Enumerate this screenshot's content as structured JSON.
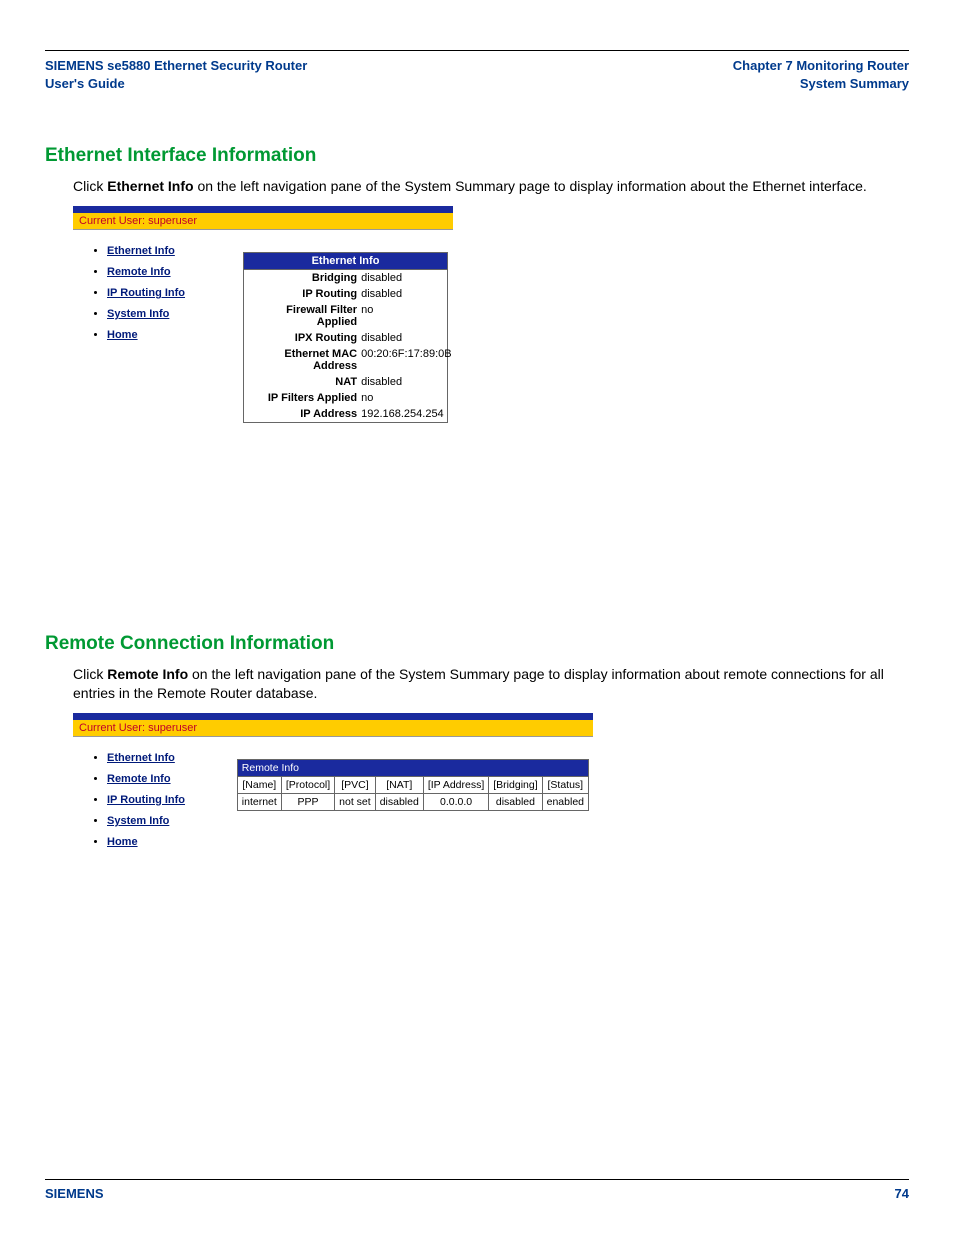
{
  "header": {
    "left_line1": "SIEMENS se5880 Ethernet Security Router",
    "left_line2": "User's Guide",
    "right_line1": "Chapter 7  Monitoring Router",
    "right_line2": "System Summary"
  },
  "section1": {
    "heading": "Ethernet Interface Information",
    "para_pre": "Click ",
    "para_bold": "Ethernet Info",
    "para_post": " on the left navigation pane of the System Summary page to display information about the Ethernet interface."
  },
  "app": {
    "current_user_label": "Current User: superuser",
    "nav": [
      "Ethernet Info",
      "Remote Info",
      "IP Routing Info",
      "System Info",
      "Home"
    ]
  },
  "eth_table": {
    "title": "Ethernet Info",
    "rows": [
      {
        "label": "Bridging",
        "value": "disabled"
      },
      {
        "label": "IP Routing",
        "value": "disabled"
      },
      {
        "label": "Firewall Filter Applied",
        "value": "no"
      },
      {
        "label": "IPX Routing",
        "value": "disabled"
      },
      {
        "label": "Ethernet MAC Address",
        "value": "00:20:6F:17:89:0B"
      },
      {
        "label": "NAT",
        "value": "disabled"
      },
      {
        "label": "IP Filters Applied",
        "value": "no"
      },
      {
        "label": "IP Address",
        "value": "192.168.254.254"
      }
    ]
  },
  "section2": {
    "heading": "Remote Connection Information",
    "para_pre": "Click ",
    "para_bold": "Remote Info",
    "para_post": " on the left navigation pane of the System Summary page to display information about remote connections for all entries in the Remote Router database."
  },
  "remote_table": {
    "title": "Remote Info",
    "headers": [
      "[Name]",
      "[Protocol]",
      "[PVC]",
      "[NAT]",
      "[IP Address]",
      "[Bridging]",
      "[Status]"
    ],
    "row": [
      "internet",
      "PPP",
      "not set",
      "disabled",
      "0.0.0.0",
      "disabled",
      "enabled"
    ]
  },
  "footer": {
    "brand": "SIEMENS",
    "page": "74"
  }
}
